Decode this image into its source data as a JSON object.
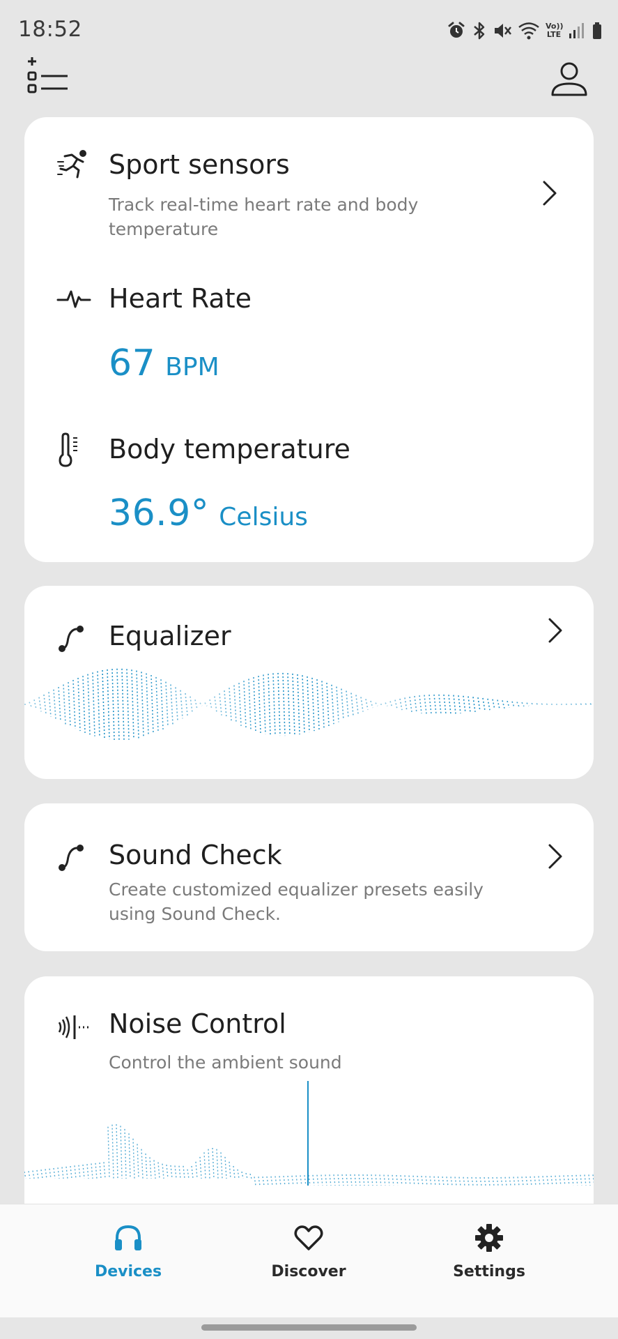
{
  "status_bar": {
    "time": "18:52",
    "icons": [
      "alarm-icon",
      "bluetooth-icon",
      "mute-icon",
      "wifi-icon",
      "volte-icon",
      "signal-icon",
      "battery-icon"
    ],
    "volte_text_1": "Vo))",
    "volte_text_2": "LTE"
  },
  "top_bar": {
    "left_icon": "add-list-icon",
    "right_icon": "profile-icon"
  },
  "sport_card": {
    "title": "Sport sensors",
    "subtitle": "Track real-time heart rate and body temperature",
    "heart_rate_title": "Heart Rate",
    "heart_rate_value": "67",
    "heart_rate_unit": "BPM",
    "temperature_title": "Body temperature",
    "temperature_value": "36.9°",
    "temperature_unit": "Celsius"
  },
  "equalizer_card": {
    "title": "Equalizer"
  },
  "sound_check_card": {
    "title": "Sound Check",
    "subtitle": "Create customized equalizer presets easily using Sound Check."
  },
  "noise_card": {
    "title": "Noise Control",
    "subtitle": "Control the ambient sound"
  },
  "bottom_nav": {
    "items": [
      {
        "label": "Devices",
        "icon": "headphones-icon",
        "active": true
      },
      {
        "label": "Discover",
        "icon": "heart-icon",
        "active": false
      },
      {
        "label": "Settings",
        "icon": "gear-icon",
        "active": false
      }
    ]
  },
  "colors": {
    "accent": "#1a8fc6",
    "background": "#e6e6e6",
    "card": "#ffffff"
  }
}
